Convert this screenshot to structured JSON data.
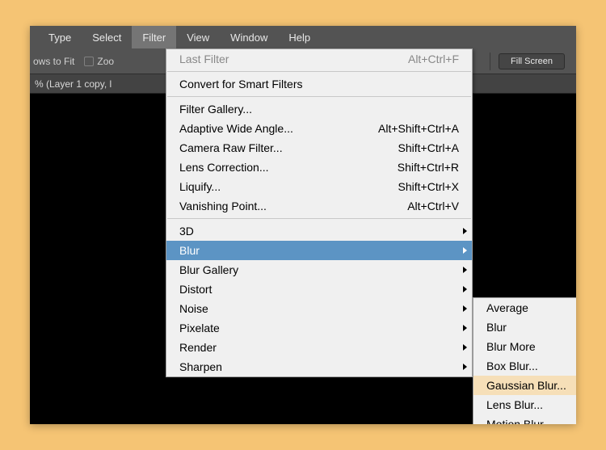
{
  "menubar": {
    "items": [
      {
        "label": "Type"
      },
      {
        "label": "Select"
      },
      {
        "label": "Filter",
        "active": true
      },
      {
        "label": "View"
      },
      {
        "label": "Window"
      },
      {
        "label": "Help"
      }
    ]
  },
  "toolbar": {
    "left_text": "ows to Fit",
    "zoom_checkbox": "Zoo",
    "fill_screen": "Fill Screen"
  },
  "tab": {
    "title": "% (Layer 1 copy, l"
  },
  "filter_menu": {
    "last_filter": {
      "label": "Last Filter",
      "shortcut": "Alt+Ctrl+F",
      "disabled": true
    },
    "convert": {
      "label": "Convert for Smart Filters"
    },
    "group2": [
      {
        "label": "Filter Gallery..."
      },
      {
        "label": "Adaptive Wide Angle...",
        "shortcut": "Alt+Shift+Ctrl+A"
      },
      {
        "label": "Camera Raw Filter...",
        "shortcut": "Shift+Ctrl+A"
      },
      {
        "label": "Lens Correction...",
        "shortcut": "Shift+Ctrl+R"
      },
      {
        "label": "Liquify...",
        "shortcut": "Shift+Ctrl+X"
      },
      {
        "label": "Vanishing Point...",
        "shortcut": "Alt+Ctrl+V"
      }
    ],
    "group3": [
      {
        "label": "3D"
      },
      {
        "label": "Blur",
        "highlight": true
      },
      {
        "label": "Blur Gallery"
      },
      {
        "label": "Distort"
      },
      {
        "label": "Noise"
      },
      {
        "label": "Pixelate"
      },
      {
        "label": "Render"
      },
      {
        "label": "Sharpen"
      }
    ]
  },
  "blur_submenu": {
    "items": [
      {
        "label": "Average"
      },
      {
        "label": "Blur"
      },
      {
        "label": "Blur More"
      },
      {
        "label": "Box Blur..."
      },
      {
        "label": "Gaussian Blur...",
        "highlight": true
      },
      {
        "label": "Lens Blur..."
      },
      {
        "label": "Motion Blur..."
      }
    ]
  }
}
